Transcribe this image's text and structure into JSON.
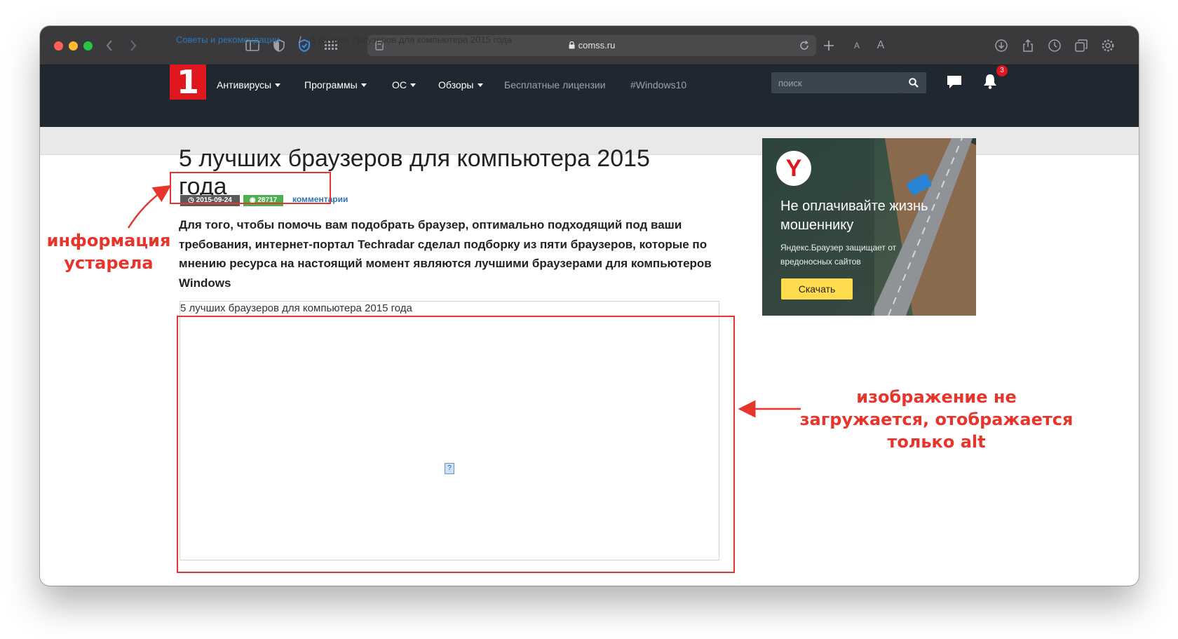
{
  "browser": {
    "url": "comss.ru"
  },
  "site": {
    "logo": "1",
    "nav": [
      {
        "label": "Антивирусы",
        "dropdown": true
      },
      {
        "label": "Программы",
        "dropdown": true
      },
      {
        "label": "ОС",
        "dropdown": true
      },
      {
        "label": "Обзоры",
        "dropdown": true
      },
      {
        "label": "Бесплатные лицензии",
        "dropdown": false
      },
      {
        "label": "#Windows10",
        "dropdown": false
      }
    ],
    "search_placeholder": "поиск",
    "notifications_count": "3"
  },
  "breadcrumb": {
    "section": "Советы и рекомендации",
    "separator": "/",
    "current": "5 лучших браузеров для компьютера 2015 года"
  },
  "article": {
    "title": "5 лучших браузеров для компьютера 2015 года",
    "date": "2015-09-24",
    "views": "28717",
    "comments_label": "комментарии",
    "lead": "Для того, чтобы помочь вам подобрать браузер, оптимально подходящий под ваши требования, интернет-портал Techradar сделал подборку из пяти браузеров, которые по мнению ресурса на настоящий момент являются лучшими браузерами для компьютеров Windows",
    "image_alt": "5 лучших браузеров для компьютера 2015 года"
  },
  "ad": {
    "logo": "Y",
    "headline": "Не оплачивайте жизнь мошеннику",
    "subtext": "Яндекс.Браузер защищает от вредоносных сайтов",
    "button": "Скачать"
  },
  "annotations": {
    "outdated": "информация устарела",
    "image_missing": "изображение не загружается, отображается только alt",
    "color": "#e8352c"
  }
}
